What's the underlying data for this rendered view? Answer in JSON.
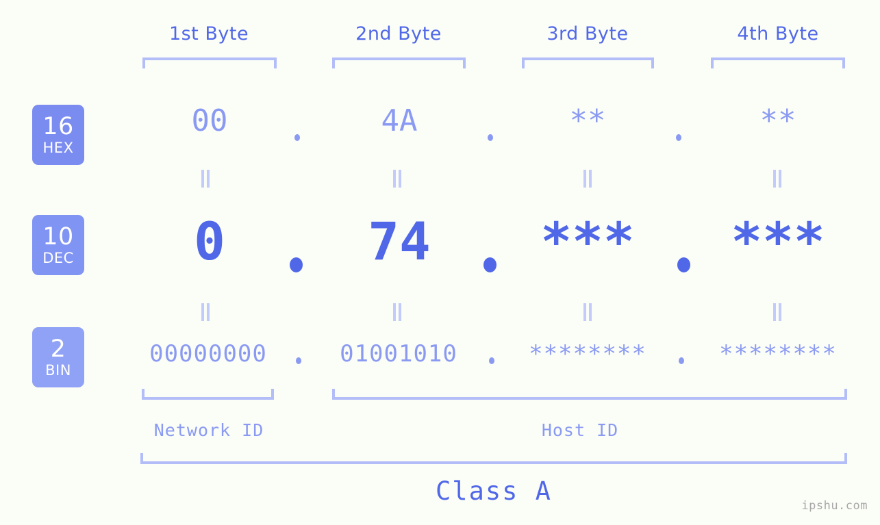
{
  "background": "#fbfdf7",
  "colors": {
    "accent_strong": "#5068e8",
    "accent_light": "#8a9af2",
    "bracket": "#b3bdf8",
    "connector": "#c3cbfa",
    "watermark": "#a8a8a8"
  },
  "byte_headers": [
    {
      "label": "1st Byte"
    },
    {
      "label": "2nd Byte"
    },
    {
      "label": "3rd Byte"
    },
    {
      "label": "4th Byte"
    }
  ],
  "bases": [
    {
      "number": "16",
      "name": "HEX",
      "color": "#7b8cf0"
    },
    {
      "number": "10",
      "name": "DEC",
      "color": "#8094f3"
    },
    {
      "number": "2",
      "name": "BIN",
      "color": "#8fa2f5"
    }
  ],
  "rows": {
    "hex": {
      "values": [
        "00",
        "4A",
        "**",
        "**"
      ]
    },
    "dec": {
      "values": [
        "0",
        "74",
        "***",
        "***"
      ]
    },
    "bin": {
      "values": [
        "00000000",
        "01001010",
        "********",
        "********"
      ]
    }
  },
  "separator": ".",
  "connector_symbol": "=",
  "sections": [
    {
      "label": "Network ID"
    },
    {
      "label": "Host ID"
    }
  ],
  "class_label": "Class A",
  "watermark": "ipshu.com"
}
